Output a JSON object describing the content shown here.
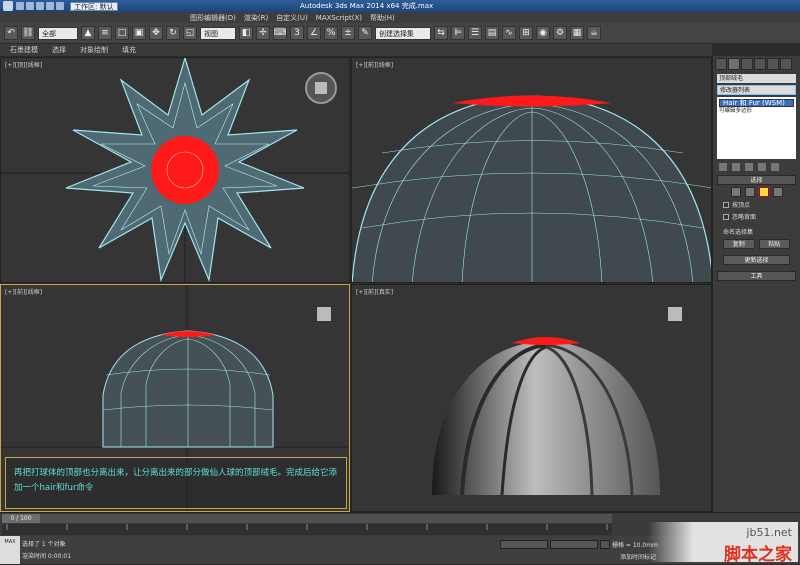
{
  "titlebar": {
    "workspace": "工作区: 默认",
    "title": "Autodesk 3ds Max  2014 x64     完成.max"
  },
  "menubar": {
    "items": [
      "图形编辑器(D)",
      "渲染(R)",
      "自定义(U)",
      "MAXScript(X)",
      "帮助(H)"
    ]
  },
  "toolbar": {
    "selection_filter": "全部",
    "view_dropdown": "视图",
    "named_sets": "创建选择集"
  },
  "ribbon": {
    "items": [
      "石墨建模",
      "选择",
      "对象绘制",
      "填充"
    ]
  },
  "viewports": {
    "top": "[+][顶][线框]",
    "perspective": "[+][前][线框]",
    "front": "[+][前][线框]",
    "shaded": "[+][前][真实]"
  },
  "annotation": {
    "text": "再把打球体的顶部也分离出来，让分离出来的部分做仙人球的顶部绒毛。完成后给它添加一个hair和fur命令"
  },
  "command_panel": {
    "object_name": "顶部绒毛",
    "modifier_list": "修改器列表",
    "stack": [
      {
        "label": "Hair 和 Fur (WSM)",
        "selected": true
      },
      {
        "label": "可编辑多边形",
        "selected": false
      }
    ],
    "selection_rollout": "选择",
    "by_vertex": "按顶点",
    "ignore_backfacing": "忽略背面",
    "named_sets": "命名选择集",
    "copy": "复制",
    "paste": "粘贴",
    "update_selection": "更新选择",
    "tools_rollout": "工具"
  },
  "timeline": {
    "frame": "0 / 100"
  },
  "status": {
    "line1": "选择了 1 个对象",
    "line2": "渲染时间 0:00:01",
    "grid": "栅格 = 10.0mm",
    "add_time_tag": "添加时间标记"
  },
  "watermark": {
    "site": "jb51.net",
    "brand": "脚本之家"
  },
  "colors": {
    "wire": "#8fe0ee",
    "red": "#ff1a1a",
    "accent": "#c9a64a"
  }
}
